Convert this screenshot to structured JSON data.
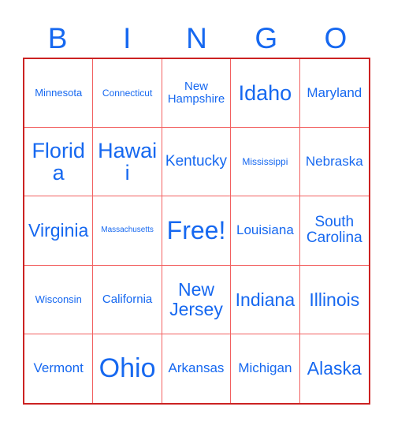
{
  "card": {
    "title": "BINGO",
    "header_letters": [
      "B",
      "I",
      "N",
      "G",
      "O"
    ],
    "accent_text_color": "#1668f0",
    "outer_border_color": "#cc2222",
    "inner_grid_color": "#f26060",
    "background_color": "#ffffff",
    "grid_size": "5x5",
    "free_space_label": "Free!",
    "rows": [
      [
        {
          "label": "Minnesota",
          "size": "md"
        },
        {
          "label": "Connecticut",
          "size": "sm"
        },
        {
          "label": "New Hampshire",
          "size": "lg"
        },
        {
          "label": "Idaho",
          "size": "4xl"
        },
        {
          "label": "Maryland",
          "size": "xl"
        }
      ],
      [
        {
          "label": "Florida",
          "size": "4xl"
        },
        {
          "label": "Hawaii",
          "size": "4xl"
        },
        {
          "label": "Kentucky",
          "size": "2xl"
        },
        {
          "label": "Mississippi",
          "size": "sm"
        },
        {
          "label": "Nebraska",
          "size": "xl"
        }
      ],
      [
        {
          "label": "Virginia",
          "size": "3xl"
        },
        {
          "label": "Massachusetts",
          "size": "xs"
        },
        {
          "label": "Free!",
          "size": "5xl"
        },
        {
          "label": "Louisiana",
          "size": "xl"
        },
        {
          "label": "South Carolina",
          "size": "2xl"
        }
      ],
      [
        {
          "label": "Wisconsin",
          "size": "md"
        },
        {
          "label": "California",
          "size": "lg"
        },
        {
          "label": "New Jersey",
          "size": "3xl"
        },
        {
          "label": "Indiana",
          "size": "3xl"
        },
        {
          "label": "Illinois",
          "size": "3xl"
        }
      ],
      [
        {
          "label": "Vermont",
          "size": "xl"
        },
        {
          "label": "Ohio",
          "size": "6xl"
        },
        {
          "label": "Arkansas",
          "size": "xl"
        },
        {
          "label": "Michigan",
          "size": "xl"
        },
        {
          "label": "Alaska",
          "size": "3xl"
        }
      ]
    ]
  }
}
